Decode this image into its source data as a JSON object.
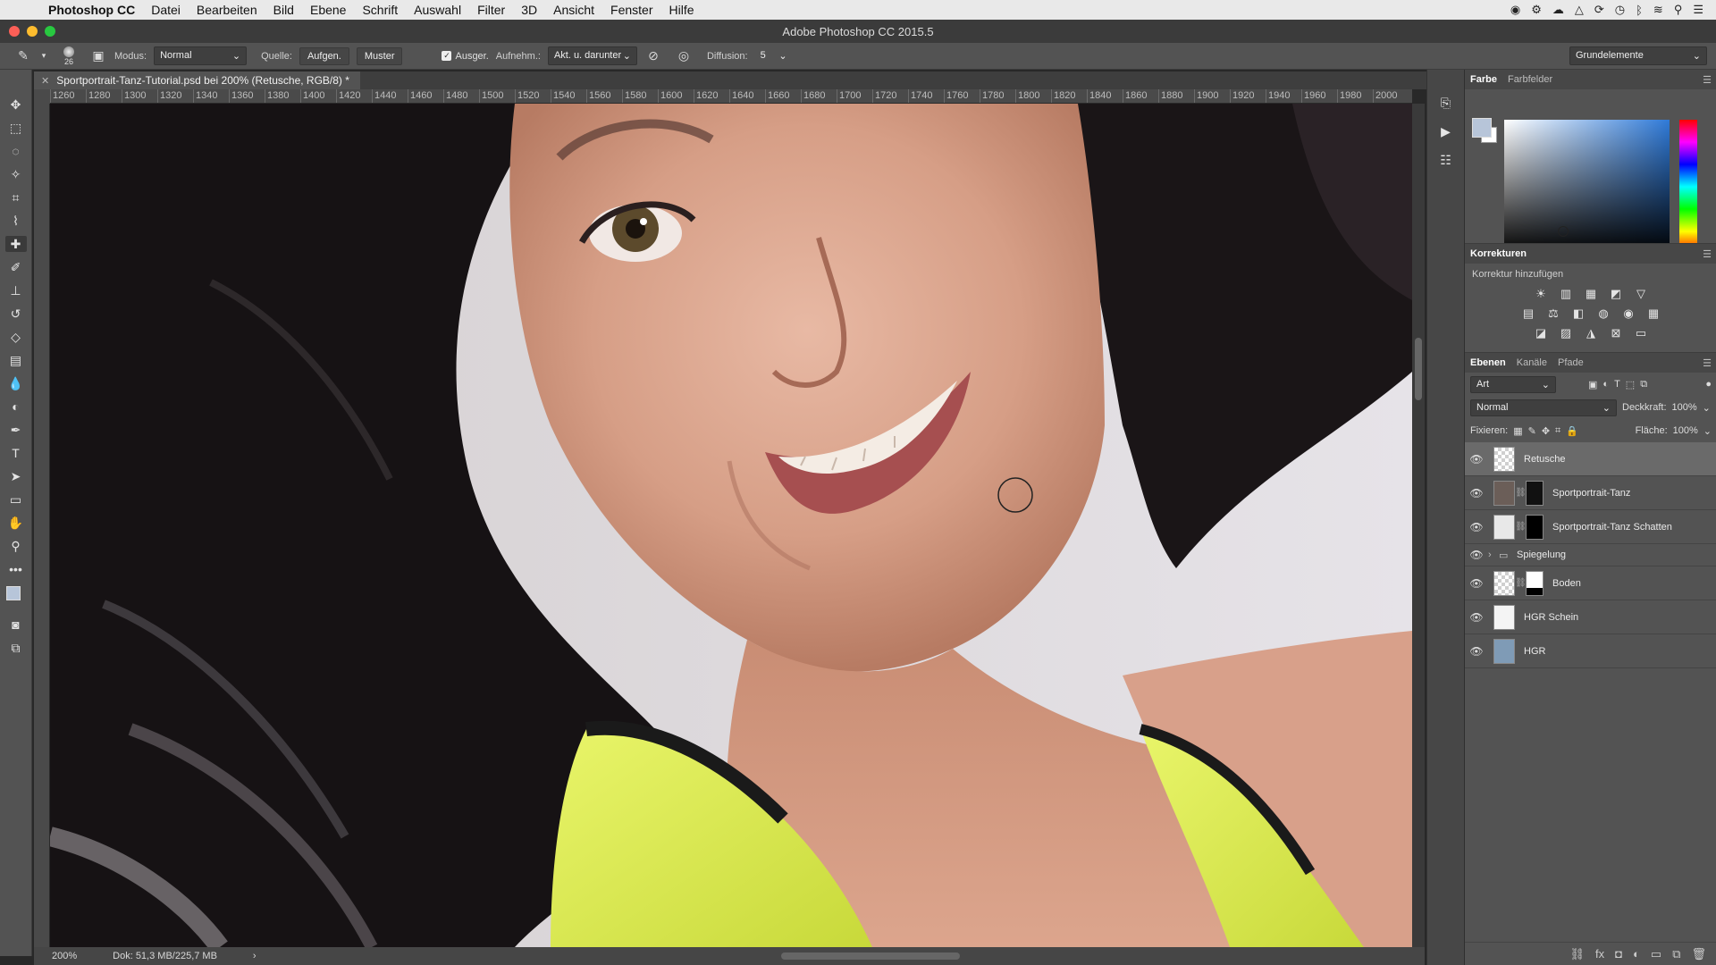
{
  "menubar": {
    "app": "Photoshop CC",
    "items": [
      "Datei",
      "Bearbeiten",
      "Bild",
      "Ebene",
      "Schrift",
      "Auswahl",
      "Filter",
      "3D",
      "Ansicht",
      "Fenster",
      "Hilfe"
    ]
  },
  "window": {
    "title": "Adobe Photoshop CC 2015.5"
  },
  "options": {
    "brush_size": "26",
    "modus_label": "Modus:",
    "modus_value": "Normal",
    "quelle_label": "Quelle:",
    "aufgen": "Aufgen.",
    "muster": "Muster",
    "ausger": "Ausger.",
    "aufnehm_label": "Aufnehm.:",
    "aufnehm_value": "Akt. u. darunter",
    "diffusion_label": "Diffusion:",
    "diffusion_value": "5",
    "workspace": "Grundelemente"
  },
  "document": {
    "tab_title": "Sportportrait-Tanz-Tutorial.psd bei 200% (Retusche, RGB/8) *",
    "ruler_ticks": [
      "1260",
      "1280",
      "1300",
      "1320",
      "1340",
      "1360",
      "1380",
      "1400",
      "1420",
      "1440",
      "1460",
      "1480",
      "1500",
      "1520",
      "1540",
      "1560",
      "1580",
      "1600",
      "1620",
      "1640",
      "1660",
      "1680",
      "1700",
      "1720",
      "1740",
      "1760",
      "1780",
      "1800",
      "1820",
      "1840",
      "1860",
      "1880",
      "1900",
      "1920",
      "1940",
      "1960",
      "1980",
      "2000"
    ]
  },
  "status": {
    "zoom": "200%",
    "doc": "Dok: 51,3 MB/225,7 MB"
  },
  "color_panel": {
    "tabs": [
      "Farbe",
      "Farbfelder"
    ],
    "foreground": "#b7c5d9",
    "background": "#ffffff"
  },
  "adjustments": {
    "title": "Korrekturen",
    "subtitle": "Korrektur hinzufügen"
  },
  "layers_panel": {
    "tabs": [
      "Ebenen",
      "Kanäle",
      "Pfade"
    ],
    "filter": "Art",
    "blend_mode": "Normal",
    "opacity_label": "Deckkraft:",
    "opacity": "100%",
    "lock_label": "Fixieren:",
    "fill_label": "Fläche:",
    "fill": "100%",
    "layers": [
      {
        "name": "Retusche",
        "selected": true
      },
      {
        "name": "Sportportrait-Tanz"
      },
      {
        "name": "Sportportrait-Tanz Schatten"
      },
      {
        "name": "Spiegelung",
        "group": true
      },
      {
        "name": "Boden"
      },
      {
        "name": "HGR Schein"
      },
      {
        "name": "HGR"
      }
    ]
  }
}
